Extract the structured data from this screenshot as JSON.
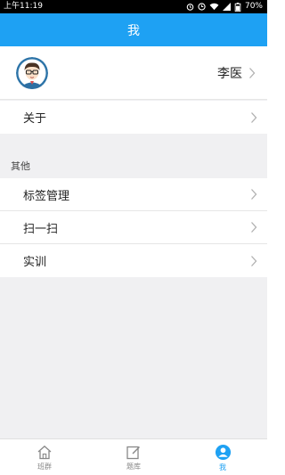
{
  "status_bar": {
    "time": "上午11:19",
    "battery": "70%"
  },
  "header": {
    "title": "我"
  },
  "profile": {
    "name": "李医"
  },
  "menu": {
    "about": "关于",
    "section_title": "其他",
    "items": [
      {
        "label": "标签管理"
      },
      {
        "label": "扫一扫"
      },
      {
        "label": "实训"
      }
    ]
  },
  "bottom_nav": {
    "items": [
      {
        "label": "班群",
        "icon": "home-icon",
        "active": false
      },
      {
        "label": "题库",
        "icon": "edit-icon",
        "active": false
      },
      {
        "label": "我",
        "icon": "person-icon",
        "active": true
      }
    ]
  },
  "colors": {
    "accent": "#1ea1f3",
    "background": "#f0f0f2"
  }
}
